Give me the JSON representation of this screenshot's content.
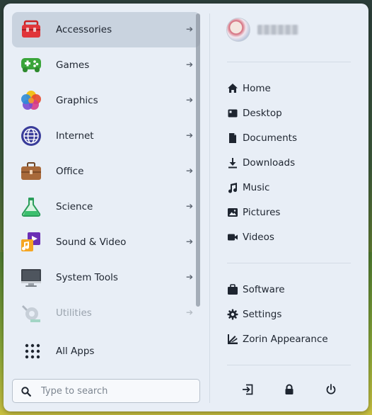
{
  "categories": [
    {
      "label": "Accessories",
      "icon": "toolbox-icon",
      "active": true
    },
    {
      "label": "Games",
      "icon": "gamepad-icon"
    },
    {
      "label": "Graphics",
      "icon": "color-wheel-icon"
    },
    {
      "label": "Internet",
      "icon": "globe-icon"
    },
    {
      "label": "Office",
      "icon": "briefcase-icon"
    },
    {
      "label": "Science",
      "icon": "flask-icon"
    },
    {
      "label": "Sound & Video",
      "icon": "media-icon"
    },
    {
      "label": "System Tools",
      "icon": "monitor-icon"
    },
    {
      "label": "Utilities",
      "icon": "utilities-icon",
      "dimmed": true
    }
  ],
  "all_apps": {
    "label": "All Apps"
  },
  "search": {
    "placeholder": "Type to search",
    "value": ""
  },
  "places": [
    {
      "label": "Home",
      "icon": "home-icon"
    },
    {
      "label": "Desktop",
      "icon": "desktop-icon"
    },
    {
      "label": "Documents",
      "icon": "document-icon"
    },
    {
      "label": "Downloads",
      "icon": "download-icon"
    },
    {
      "label": "Music",
      "icon": "music-icon"
    },
    {
      "label": "Pictures",
      "icon": "pictures-icon"
    },
    {
      "label": "Videos",
      "icon": "video-icon"
    }
  ],
  "system": [
    {
      "label": "Software",
      "icon": "software-icon"
    },
    {
      "label": "Settings",
      "icon": "gear-icon"
    },
    {
      "label": "Zorin Appearance",
      "icon": "appearance-icon"
    }
  ],
  "actions": [
    {
      "name": "logout-button",
      "icon": "logout-icon"
    },
    {
      "name": "lock-button",
      "icon": "lock-icon"
    },
    {
      "name": "power-button",
      "icon": "power-icon"
    }
  ]
}
